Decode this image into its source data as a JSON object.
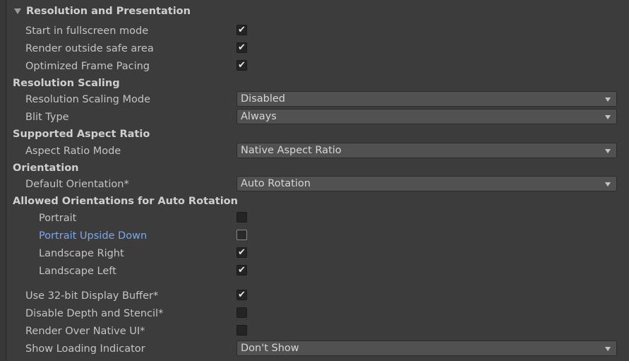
{
  "section": {
    "title": "Resolution and Presentation"
  },
  "rows": {
    "start_fullscreen": {
      "label": "Start in fullscreen mode",
      "checked": true
    },
    "render_outside_safe": {
      "label": "Render outside safe area",
      "checked": true
    },
    "optimized_frame_pacing": {
      "label": "Optimized Frame Pacing",
      "checked": true
    },
    "resolution_scaling_header": "Resolution Scaling",
    "resolution_scaling_mode": {
      "label": "Resolution Scaling Mode",
      "value": "Disabled"
    },
    "blit_type": {
      "label": "Blit Type",
      "value": "Always"
    },
    "supported_aspect_header": "Supported Aspect Ratio",
    "aspect_ratio_mode": {
      "label": "Aspect Ratio Mode",
      "value": "Native Aspect Ratio"
    },
    "orientation_header": "Orientation",
    "default_orientation": {
      "label": "Default Orientation*",
      "value": "Auto Rotation"
    },
    "allowed_orientations_header": "Allowed Orientations for Auto Rotation",
    "portrait": {
      "label": "Portrait",
      "checked": false
    },
    "portrait_upside_down": {
      "label": "Portrait Upside Down",
      "checked": false
    },
    "landscape_right": {
      "label": "Landscape Right",
      "checked": true
    },
    "landscape_left": {
      "label": "Landscape Left",
      "checked": true
    },
    "use_32bit_buffer": {
      "label": "Use 32-bit Display Buffer*",
      "checked": true
    },
    "disable_depth_stencil": {
      "label": "Disable Depth and Stencil*",
      "checked": false
    },
    "render_over_native_ui": {
      "label": "Render Over Native UI*",
      "checked": false
    },
    "show_loading_indicator": {
      "label": "Show Loading Indicator",
      "value": "Don't Show"
    }
  },
  "icons": {
    "check": "✔",
    "foldout": "triangle-down-icon",
    "dropdown": "chevron-down-icon"
  },
  "colors": {
    "background": "#3c3c3c",
    "highlight_label": "#7ba7ea",
    "focus_border": "#5a8fd8"
  }
}
